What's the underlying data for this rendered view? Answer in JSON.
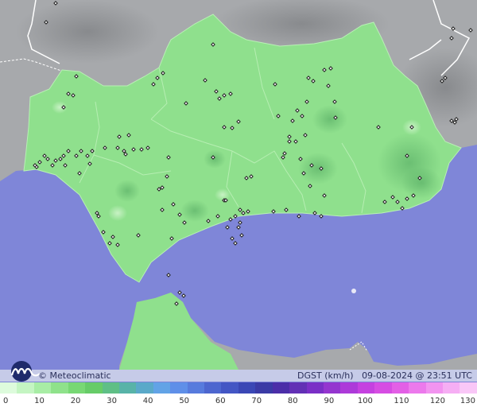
{
  "footer": {
    "brand": "© Meteoclimatic",
    "variable": "DGST (km/h)",
    "timestamp": "09-08-2024 @ 23:51 UTC"
  },
  "legend": {
    "ticks": [
      "0",
      "10",
      "20",
      "30",
      "40",
      "50",
      "60",
      "70",
      "80",
      "90",
      "100",
      "110",
      "120",
      "130"
    ],
    "colors": [
      "#ddfbdc",
      "#c4f5c2",
      "#a8eda5",
      "#8fe28b",
      "#78d874",
      "#67cc68",
      "#5fbf86",
      "#58b3a8",
      "#5aa9c9",
      "#62a3e6",
      "#5f8fe8",
      "#577bdd",
      "#4d66cf",
      "#4356c4",
      "#3a47b5",
      "#3a3aa5",
      "#4b2ea8",
      "#6230b5",
      "#7a2fc6",
      "#9435cf",
      "#ad3ad9",
      "#c541e0",
      "#d64de3",
      "#e35fe6",
      "#ec79ec",
      "#f294f0",
      "#f6aef4",
      "#f9c7f7"
    ]
  },
  "colors": {
    "sea": "#7f86d8",
    "land_other": "#a6a8ab",
    "land_main": "#8fe08d",
    "station": "#222222"
  },
  "icons": {
    "logo": "meteoclimatic-logo-icon",
    "station": "station-marker-icon"
  }
}
